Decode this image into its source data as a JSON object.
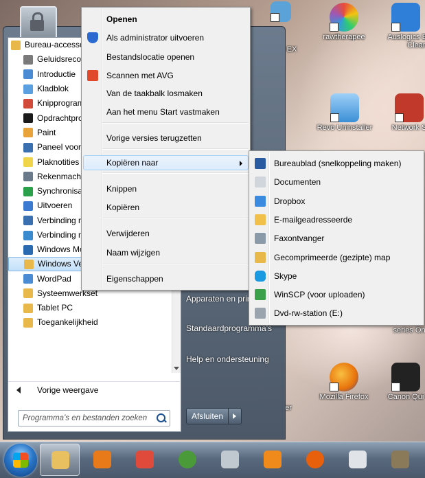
{
  "desktop": {
    "icons": [
      {
        "label": "",
        "color": "#5aa2d8"
      },
      {
        "label": "EX",
        "color": "#d0d0d0"
      },
      {
        "label": "rawtherapee",
        "color": "#e74c3c"
      },
      {
        "label": "Auslogics B Clean",
        "color": "#2f7ed8"
      },
      {
        "label": "Revo Uninstaller",
        "color": "#3b8fd6"
      },
      {
        "label": "Network S",
        "color": "#c0392b"
      },
      {
        "label": "series On",
        "color": "#7d7d7d"
      },
      {
        "label": "er",
        "color": "#888888"
      },
      {
        "label": "Mozilla Firefox",
        "color": "#e8730c"
      },
      {
        "label": "Canon Qui",
        "color": "#222222"
      }
    ]
  },
  "start_menu": {
    "programs": [
      {
        "label": "Bureau-accessoires",
        "icon": "folder-icon",
        "color": "#e8b84a",
        "indent": false
      },
      {
        "label": "Geluidsrecorder",
        "icon": "microphone-icon",
        "color": "#7a7a7a",
        "indent": true
      },
      {
        "label": "Introductie",
        "icon": "document-icon",
        "color": "#4a8bd4",
        "indent": true
      },
      {
        "label": "Kladblok",
        "icon": "notepad-icon",
        "color": "#5aa0e0",
        "indent": true
      },
      {
        "label": "Knipprogramma",
        "icon": "scissors-icon",
        "color": "#d24a3a",
        "indent": true
      },
      {
        "label": "Opdrachtprompt",
        "icon": "console-icon",
        "color": "#1a1a1a",
        "indent": true
      },
      {
        "label": "Paint",
        "icon": "paint-icon",
        "color": "#e8a33a",
        "indent": true
      },
      {
        "label": "Paneel voor wiskunde-invoer",
        "icon": "pen-icon",
        "color": "#3a6fb0",
        "indent": true
      },
      {
        "label": "Plaknotities",
        "icon": "sticky-note-icon",
        "color": "#f0d54a",
        "indent": true
      },
      {
        "label": "Rekenmachine",
        "icon": "calculator-icon",
        "color": "#6a7a8a",
        "indent": true
      },
      {
        "label": "Synchronisatiecentrum",
        "icon": "sync-icon",
        "color": "#2aa04a",
        "indent": true
      },
      {
        "label": "Uitvoeren",
        "icon": "run-icon",
        "color": "#3a7ad0",
        "indent": true
      },
      {
        "label": "Verbinding met een netwerkprojector",
        "icon": "projector-icon",
        "color": "#3a6fb0",
        "indent": true
      },
      {
        "label": "Verbinding met extern bureaublad",
        "icon": "remote-desktop-icon",
        "color": "#3a8ad0",
        "indent": true
      },
      {
        "label": "Windows Mobiliteitscentrum",
        "icon": "mobility-icon",
        "color": "#2a6ab0",
        "indent": true
      },
      {
        "label": "Windows Verkenner",
        "icon": "explorer-icon",
        "color": "#e8b84a",
        "indent": true,
        "selected": true
      },
      {
        "label": "WordPad",
        "icon": "wordpad-icon",
        "color": "#4a8bd4",
        "indent": true
      },
      {
        "label": "Systeemwerkset",
        "icon": "folder-icon",
        "color": "#e8b84a",
        "indent": true
      },
      {
        "label": "Tablet PC",
        "icon": "folder-icon",
        "color": "#e8b84a",
        "indent": true
      },
      {
        "label": "Toegankelijkheid",
        "icon": "folder-icon",
        "color": "#e8b84a",
        "indent": true
      }
    ],
    "back_label": "Vorige weergave",
    "search_placeholder": "Programma's en bestanden zoeken",
    "right_items": [
      {
        "label": "Apparaten en printers"
      },
      {
        "label": "Standaardprogramma's"
      },
      {
        "label": "Help en ondersteuning"
      }
    ],
    "shutdown_label": "Afsluiten"
  },
  "context_menu": {
    "items": [
      {
        "label": "Openen",
        "bold": true
      },
      {
        "label": "Als administrator uitvoeren",
        "icon": "shield-icon",
        "color": "#2a6ad0"
      },
      {
        "label": "Bestandslocatie openen"
      },
      {
        "label": "Scannen met AVG",
        "icon": "avg-icon",
        "color": "#e04a2a"
      },
      {
        "label": "Van de taakbalk losmaken"
      },
      {
        "label": "Aan het menu Start vastmaken"
      },
      {
        "label": "Vorige versies terugzetten"
      },
      {
        "label": "Kopiëren naar",
        "submenu": true
      },
      {
        "label": "Knippen"
      },
      {
        "label": "Kopiëren"
      },
      {
        "label": "Verwijderen"
      },
      {
        "label": "Naam wijzigen"
      },
      {
        "label": "Eigenschappen"
      }
    ]
  },
  "copy_to_menu": {
    "items": [
      {
        "label": "Bureaublad (snelkoppeling maken)",
        "icon": "desktop-icon",
        "color": "#2a5aa0"
      },
      {
        "label": "Documenten",
        "icon": "documents-icon",
        "color": "#d0d6dc"
      },
      {
        "label": "Dropbox",
        "icon": "dropbox-icon",
        "color": "#3a8ae0"
      },
      {
        "label": "E-mailgeadresseerde",
        "icon": "mail-recipient-icon",
        "color": "#f0c04a"
      },
      {
        "label": "Faxontvanger",
        "icon": "fax-icon",
        "color": "#8a9aa8"
      },
      {
        "label": "Gecomprimeerde (gezipte) map",
        "icon": "zip-folder-icon",
        "color": "#e8b84a"
      },
      {
        "label": "Skype",
        "icon": "skype-icon",
        "color": "#1a9ae0"
      },
      {
        "label": "WinSCP (voor uploaden)",
        "icon": "winscp-icon",
        "color": "#3aa04a"
      },
      {
        "label": "Dvd-rw-station (E:)",
        "icon": "dvd-drive-icon",
        "color": "#9aa4ae"
      }
    ]
  },
  "taskbar": {
    "items": [
      {
        "name": "explorer-taskbar-button",
        "icon": "folder-icon",
        "color": "#e8c060",
        "active": true
      },
      {
        "name": "media-player-taskbar-button",
        "icon": "media-player-icon",
        "color": "#e87a1a"
      },
      {
        "name": "paint-taskbar-button",
        "icon": "paint-icon",
        "color": "#e04a3a"
      },
      {
        "name": "chrome-taskbar-button",
        "icon": "chrome-icon",
        "color": "#4a9a3a"
      },
      {
        "name": "graphics-taskbar-button",
        "icon": "palette-icon",
        "color": "#c0c8d0"
      },
      {
        "name": "vlc-taskbar-button",
        "icon": "vlc-icon",
        "color": "#f08a1a"
      },
      {
        "name": "firefox-taskbar-button",
        "icon": "firefox-icon",
        "color": "#e8600c"
      },
      {
        "name": "notes-taskbar-button",
        "icon": "clipboard-icon",
        "color": "#e0e4e8"
      },
      {
        "name": "gimp-taskbar-button",
        "icon": "gimp-icon",
        "color": "#8a7a5a"
      }
    ]
  }
}
